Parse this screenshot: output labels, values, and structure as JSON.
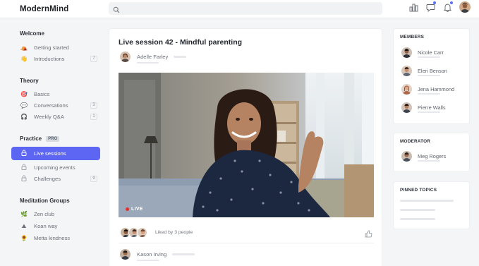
{
  "app": {
    "logo": "ModernMind"
  },
  "topbar": {
    "search": {
      "placeholder": "",
      "icon": "search-icon"
    },
    "icons": [
      "chart-icon",
      "chat-icon",
      "bell-icon",
      "user-avatar"
    ]
  },
  "sidebar": {
    "sections": [
      {
        "title": "Welcome",
        "items": [
          {
            "label": "Getting started",
            "icon": "⛺",
            "count": ""
          },
          {
            "label": "Introductions",
            "icon": "👋",
            "count": "7"
          }
        ]
      },
      {
        "title": "Theory",
        "items": [
          {
            "label": "Basics",
            "icon": "🎯",
            "count": ""
          },
          {
            "label": "Conversations",
            "icon": "💬",
            "count": "3"
          },
          {
            "label": "Weekly Q&A",
            "icon": "🎧",
            "count": "1"
          }
        ]
      },
      {
        "title": "Practice",
        "badge": "PRO",
        "items": [
          {
            "label": "Live sessions",
            "icon": "lock-icon",
            "count": "",
            "active": true
          },
          {
            "label": "Upcoming events",
            "icon": "lock-icon",
            "count": ""
          },
          {
            "label": "Challenges",
            "icon": "lock-icon",
            "count": "9"
          }
        ]
      },
      {
        "title": "Meditation Groups",
        "items": [
          {
            "label": "Zen club",
            "icon": "🌿",
            "count": ""
          },
          {
            "label": "Koan way",
            "icon": "⛰",
            "count": ""
          },
          {
            "label": "Metta kindness",
            "icon": "🌻",
            "count": ""
          }
        ]
      }
    ]
  },
  "main": {
    "title": "Live session 42 - Mindful parenting",
    "author": "Adelle Farley",
    "video": {
      "live_label": "LIVE"
    },
    "likes_text": "Liked by 3 people",
    "comment": {
      "author": "Kason Irving"
    }
  },
  "members": {
    "title": "MEMBERS",
    "list": [
      "Nicole Carr",
      "Eleri Benson",
      "Jena Hammond",
      "Pierre Walls"
    ]
  },
  "moderator": {
    "title": "MODERATOR",
    "name": "Meg Rogers"
  },
  "pinned": {
    "title": "PINNED TOPICS"
  },
  "colors": {
    "accent": "#5c66f2",
    "live": "#e03131",
    "background": "#f4f5f7"
  }
}
